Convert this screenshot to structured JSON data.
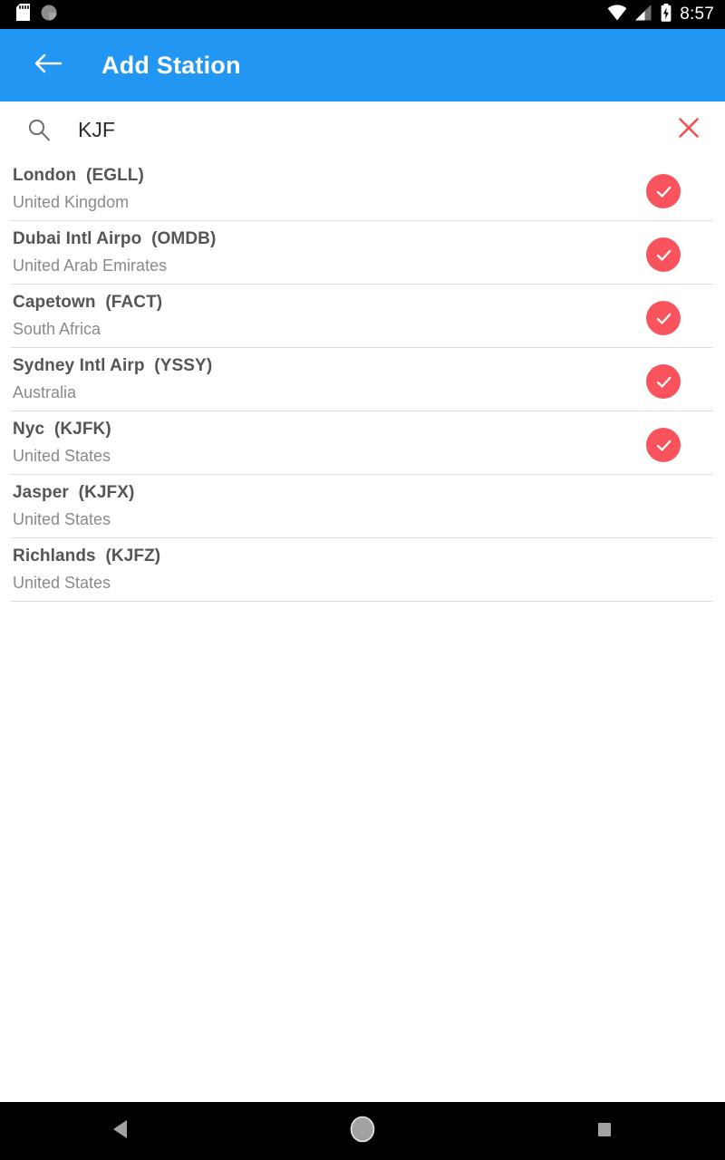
{
  "status_bar": {
    "time": "8:57",
    "left_icons": [
      "sd-card-icon",
      "sync-circle-icon"
    ],
    "right_icons": [
      "wifi-icon",
      "cellular-signal-icon",
      "battery-charging-icon"
    ],
    "background_color": "#000000"
  },
  "toolbar": {
    "title": "Add Station",
    "back_icon": "back-arrow-icon",
    "background_color": "#2196f3",
    "text_color": "#ffffff"
  },
  "search": {
    "value": "KJF",
    "placeholder": "Search",
    "search_icon": "search-icon",
    "clear_icon": "close-x-icon",
    "clear_color": "#f25a5a"
  },
  "list": {
    "selected_color": "#f9545e",
    "rows": [
      {
        "name": "London",
        "code": "(EGLL)",
        "country": "United Kingdom",
        "selected": true
      },
      {
        "name": "Dubai Intl Airpo",
        "code": "(OMDB)",
        "country": "United Arab Emirates",
        "selected": true
      },
      {
        "name": "Capetown",
        "code": "(FACT)",
        "country": "South Africa",
        "selected": true
      },
      {
        "name": "Sydney Intl Airp",
        "code": "(YSSY)",
        "country": "Australia",
        "selected": true
      },
      {
        "name": "Nyc",
        "code": "(KJFK)",
        "country": "United States",
        "selected": true
      },
      {
        "name": "Jasper",
        "code": "(KJFX)",
        "country": "United States",
        "selected": false
      },
      {
        "name": "Richlands",
        "code": "(KJFZ)",
        "country": "United States",
        "selected": false
      }
    ]
  },
  "nav_bar": {
    "back_label": "back-triangle-icon",
    "home_label": "home-circle-icon",
    "recents_label": "recents-square-icon",
    "background_color": "#000000"
  }
}
